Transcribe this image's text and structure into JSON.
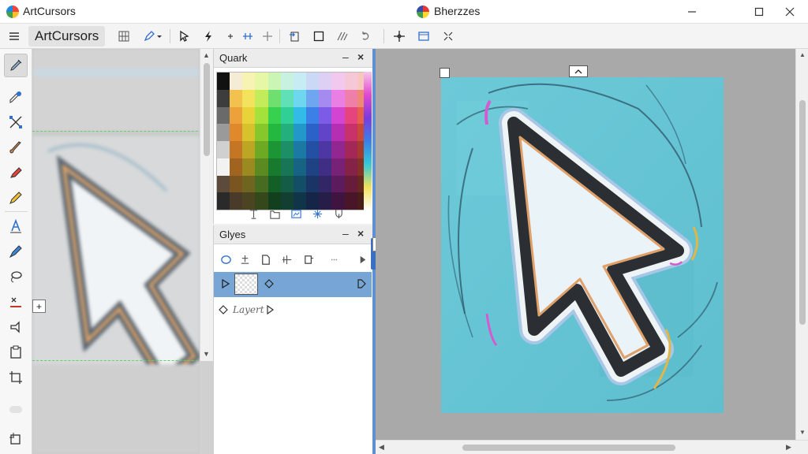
{
  "app": {
    "title": "ArtCursors"
  },
  "document": {
    "title": "Bherzzes"
  },
  "toolbar": {
    "app_button_label": "ArtCursors",
    "icons": [
      "menu-icon",
      "grid-icon",
      "pen-dropdown-icon",
      "select-arrow-icon",
      "lightning-icon",
      "node-icon",
      "align-icon",
      "plus-icon",
      "import-icon",
      "square-icon",
      "slash-path-icon",
      "rotate-path-icon",
      "crosshair-icon",
      "frame-icon",
      "scatter-icon"
    ]
  },
  "tools": [
    "paint-brush-icon",
    "eyedropper-icon",
    "transform-icon",
    "brush-icon",
    "marker-icon",
    "pencil-icon",
    "text-icon",
    "pen-icon",
    "lasso-icon",
    "eraser-icon",
    "shape-icon",
    "paste-icon",
    "crop-icon",
    "blob-icon",
    "artboard-icon"
  ],
  "palette_panel": {
    "title": "Quark",
    "minimize_label": "–",
    "close_label": "×",
    "colors": [
      "#111111",
      "#f5ecd6",
      "#f7f3b2",
      "#e6f7a6",
      "#cbf5b4",
      "#c8f1df",
      "#c8ecf4",
      "#cbd9f6",
      "#ddd0f4",
      "#f2c8ef",
      "#f6c8d7",
      "#f6c6bf",
      "#3d3d3d",
      "#f2c14e",
      "#f2e25c",
      "#c2ec5a",
      "#6fe06f",
      "#5fe0b6",
      "#6ed6ef",
      "#6ea7ef",
      "#a58bef",
      "#e97fe4",
      "#ef7fa8",
      "#ef8a72",
      "#6a6a6a",
      "#eda13a",
      "#e8d33b",
      "#a4e13a",
      "#37d14f",
      "#30cf96",
      "#32bbe6",
      "#3a80e6",
      "#7c5be6",
      "#d444d3",
      "#e6447f",
      "#e6604a",
      "#9a9a9a",
      "#e0892c",
      "#d7c12c",
      "#86c82c",
      "#24b840",
      "#23b07c",
      "#2298c8",
      "#2b62c8",
      "#6144c8",
      "#b42fb2",
      "#c8316a",
      "#c84a36",
      "#d0d0d0",
      "#c57624",
      "#bca624",
      "#6ea924",
      "#1c9635",
      "#1c8f66",
      "#1b7aa3",
      "#2450a3",
      "#4d37a3",
      "#932792",
      "#a32857",
      "#a33c2c",
      "#f2f2f2",
      "#a16420",
      "#9a8a20",
      "#5b8a20",
      "#187a2d",
      "#187556",
      "#176384",
      "#1f4284",
      "#3f2e84",
      "#772177",
      "#842248",
      "#843226",
      "#5c4a3a",
      "#7a5520",
      "#6f6520",
      "#476b20",
      "#145f25",
      "#145c45",
      "#134d66",
      "#1a3466",
      "#322666",
      "#5c1b5c",
      "#661c3a",
      "#66291f",
      "#2a2a2a",
      "#4a3a2a",
      "#4a4520",
      "#35481c",
      "#123f1e",
      "#123f32",
      "#103548",
      "#152548",
      "#261d48",
      "#401441",
      "#481529",
      "#481e18"
    ],
    "footer_icons": [
      "text-baseline-icon",
      "folder-icon",
      "image-edit-icon",
      "sparkle-icon",
      "fork-icon"
    ]
  },
  "glyphs_panel": {
    "title": "Glyes",
    "minimize_label": "–",
    "close_label": "×",
    "toolbar_icons": [
      "ellipse-icon",
      "stamp-icon",
      "document-icon",
      "tag-icon",
      "panel-icon",
      "more-icon",
      "play-icon"
    ],
    "rows": [
      {
        "label": "",
        "selected": true
      },
      {
        "label": "Layert",
        "selected": false
      }
    ]
  },
  "colors": {
    "accent": "#5f8fd0",
    "selection": "#77a6d6",
    "artboard": "#6cc7d6",
    "cursor_fill": "#eef6fa",
    "cursor_outline": "#2b2f33",
    "guide": "#5fd35f"
  }
}
